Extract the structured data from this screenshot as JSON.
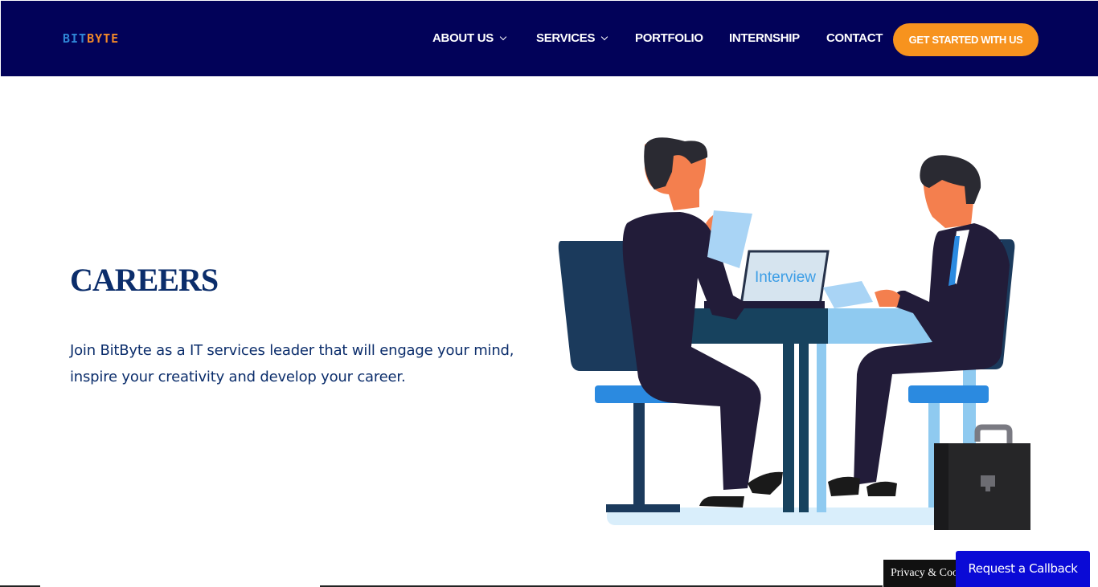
{
  "header": {
    "logo": {
      "part1": "BIT",
      "part2": "BYTE"
    },
    "nav": [
      {
        "label": "ABOUT US",
        "has_dropdown": true
      },
      {
        "label": "SERVICES",
        "has_dropdown": true
      },
      {
        "label": "PORTFOLIO",
        "has_dropdown": false
      },
      {
        "label": "INTERNSHIP",
        "has_dropdown": false
      },
      {
        "label": "CONTACT",
        "has_dropdown": false
      }
    ],
    "cta_label": "GET STARTED WITH US"
  },
  "hero": {
    "title": "CAREERS",
    "description": "Join BitByte as a IT services leader that will engage your mind, inspire your creativity and develop your career.",
    "illustration": {
      "laptop_text": "Interview"
    }
  },
  "footer_widgets": {
    "cookie_label": "Privacy & Cookies",
    "callback_label": "Request a Callback"
  },
  "colors": {
    "header_bg": "#020259",
    "accent_orange": "#f7931e",
    "heading_blue": "#0b2d6b",
    "callback_blue": "#0a0ad6"
  }
}
